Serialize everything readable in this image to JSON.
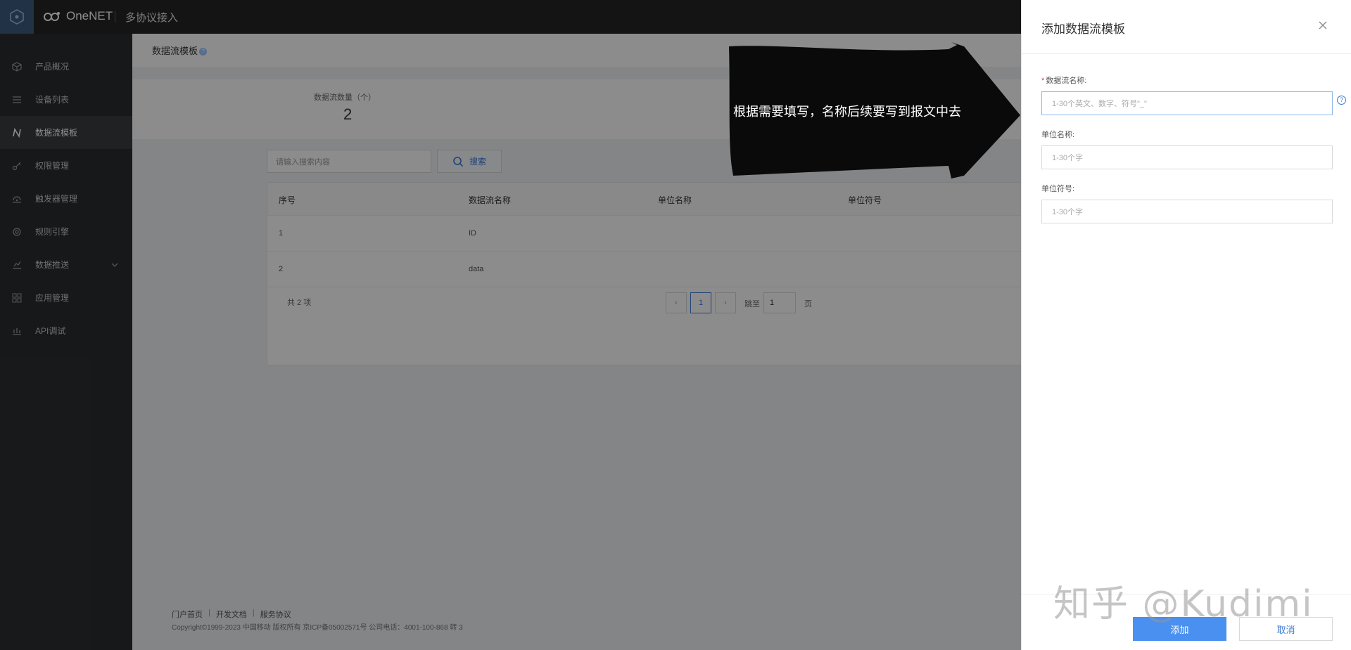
{
  "header": {
    "brand": "OneNET",
    "section": "多协议接入"
  },
  "sidebar": {
    "items": [
      {
        "label": "产品概况",
        "icon": "cube-icon"
      },
      {
        "label": "设备列表",
        "icon": "list-icon"
      },
      {
        "label": "数据流模板",
        "icon": "stream-icon",
        "active": true
      },
      {
        "label": "权限管理",
        "icon": "key-icon"
      },
      {
        "label": "触发器管理",
        "icon": "trigger-icon"
      },
      {
        "label": "规则引擎",
        "icon": "rule-icon"
      },
      {
        "label": "数据推送",
        "icon": "push-icon"
      },
      {
        "label": "应用管理",
        "icon": "apps-icon"
      },
      {
        "label": "API调试",
        "icon": "api-icon"
      }
    ]
  },
  "page": {
    "title": "数据流模板",
    "help": "?",
    "stats_label": "数据流数量（个）",
    "stats_value": "2"
  },
  "search": {
    "placeholder": "请输入搜索内容",
    "button": "搜索"
  },
  "table": {
    "columns": [
      "序号",
      "数据流名称",
      "单位名称",
      "单位符号"
    ],
    "rows": [
      [
        "1",
        "ID",
        "",
        ""
      ],
      [
        "2",
        "data",
        "",
        ""
      ]
    ]
  },
  "pagination": {
    "total": "共 2 项",
    "prev": "‹",
    "current": "1",
    "next": "›",
    "jump_label": "跳至",
    "jump_value": "1",
    "page_unit": "页"
  },
  "footer": {
    "links": [
      "门户首页",
      "开发文档",
      "服务协议"
    ],
    "copyright": "Copyright©1999-2023 中国移动 版权所有 京ICP备05002571号 公司电话：4001-100-868 转 3"
  },
  "annotation": {
    "text": "根据需要填写，名称后续要写到报文中去"
  },
  "drawer": {
    "title": "添加数据流模板",
    "close": "×",
    "fields": [
      {
        "label": "数据流名称:",
        "required": "*",
        "placeholder": "1-30个英文、数字、符号\"_\""
      },
      {
        "label": "单位名称:",
        "placeholder": "1-30个字"
      },
      {
        "label": "单位符号:",
        "placeholder": "1-30个字"
      }
    ],
    "help": "?",
    "submit": "添加",
    "cancel": "取消"
  },
  "watermark": "知乎 @Kudimi",
  "colors": {
    "primary": "#4a90f0",
    "topbar": "#252525",
    "sidebar": "#2b2d31"
  }
}
